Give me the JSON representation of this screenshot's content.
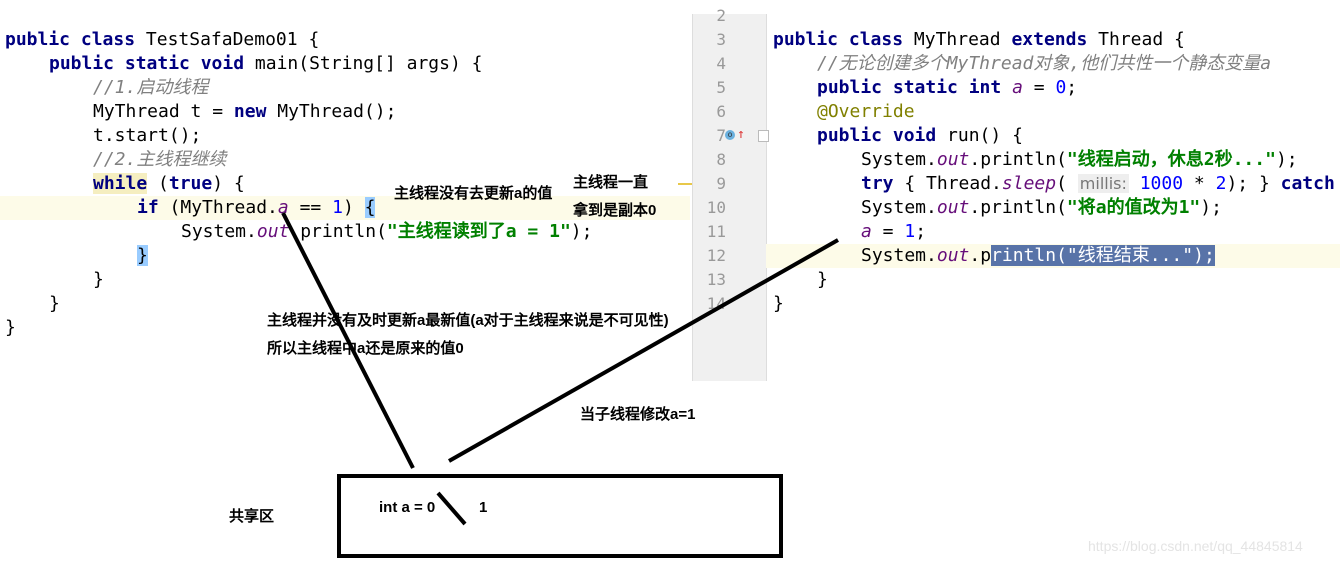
{
  "left_code": [
    {
      "indent": 0,
      "tokens": [
        [
          "public class ",
          "kw"
        ],
        [
          "TestSafaDemo01 {",
          ""
        ]
      ]
    },
    {
      "indent": 1,
      "tokens": [
        [
          "public static void ",
          "kw"
        ],
        [
          "main(String[] args) {",
          ""
        ]
      ]
    },
    {
      "indent": 2,
      "tokens": [
        [
          "//1.启动线程",
          "cm"
        ]
      ]
    },
    {
      "indent": 2,
      "tokens": [
        [
          "MyThread t = ",
          ""
        ],
        [
          "new ",
          "kw"
        ],
        [
          "MyThread();",
          ""
        ]
      ]
    },
    {
      "indent": 2,
      "tokens": [
        [
          "t.start();",
          ""
        ]
      ]
    },
    {
      "indent": 2,
      "tokens": [
        [
          "//2.主线程继续",
          "cm"
        ]
      ]
    },
    {
      "indent": 2,
      "tokens": [
        [
          "while",
          "kw whl"
        ],
        [
          " (",
          ""
        ],
        [
          "true",
          "kw"
        ],
        [
          ") {",
          ""
        ]
      ]
    },
    {
      "indent": 3,
      "tokens": [
        [
          "if ",
          "kw"
        ],
        [
          "(MyThread.",
          ""
        ],
        [
          "a",
          "fd"
        ],
        [
          " == ",
          ""
        ],
        [
          "1",
          "nu"
        ],
        [
          ") ",
          ""
        ],
        [
          "{",
          "brace"
        ]
      ]
    },
    {
      "indent": 4,
      "tokens": [
        [
          "System.",
          ""
        ],
        [
          "out",
          "fd"
        ],
        [
          ".println(",
          ""
        ],
        [
          "\"主线程读到了a = 1\"",
          "st"
        ],
        [
          ");",
          ""
        ]
      ]
    },
    {
      "indent": 3,
      "tokens": [
        [
          "}",
          "brace"
        ]
      ]
    },
    {
      "indent": 2,
      "tokens": [
        [
          "}",
          ""
        ]
      ]
    },
    {
      "indent": 1,
      "tokens": [
        [
          "}",
          ""
        ]
      ]
    },
    {
      "indent": 0,
      "tokens": [
        [
          "}",
          ""
        ]
      ]
    }
  ],
  "right_code": [
    {
      "num": "2",
      "indent": 0,
      "tokens": []
    },
    {
      "num": "3",
      "indent": 0,
      "tokens": [
        [
          "public class ",
          "kw"
        ],
        [
          "MyThread ",
          ""
        ],
        [
          "extends ",
          "kw"
        ],
        [
          "Thread {",
          ""
        ]
      ]
    },
    {
      "num": "4",
      "indent": 1,
      "tokens": [
        [
          "//无论创建多个MyThread对象,他们共性一个静态变量a",
          "cm"
        ]
      ]
    },
    {
      "num": "5",
      "indent": 1,
      "tokens": [
        [
          "public static int ",
          "kw"
        ],
        [
          "a",
          "fd"
        ],
        [
          " = ",
          ""
        ],
        [
          "0",
          "nu"
        ],
        [
          ";",
          ""
        ]
      ]
    },
    {
      "num": "6",
      "indent": 1,
      "tokens": [
        [
          "@Override",
          "an"
        ]
      ]
    },
    {
      "num": "7",
      "indent": 1,
      "tokens": [
        [
          "public void ",
          "kw"
        ],
        [
          "run() {",
          ""
        ]
      ]
    },
    {
      "num": "8",
      "indent": 2,
      "tokens": [
        [
          "System.",
          ""
        ],
        [
          "out",
          "fd"
        ],
        [
          ".println(",
          ""
        ],
        [
          "\"线程启动，休息2秒...\"",
          "st"
        ],
        [
          ");",
          ""
        ]
      ]
    },
    {
      "num": "9",
      "indent": 2,
      "tokens": [
        [
          "try ",
          "kw"
        ],
        [
          "{ Thread.",
          ""
        ],
        [
          "sleep",
          "fd"
        ],
        [
          "( ",
          ""
        ],
        [
          "millis:",
          "hint"
        ],
        [
          " ",
          ""
        ],
        [
          "1000",
          "nu"
        ],
        [
          " * ",
          ""
        ],
        [
          "2",
          "nu"
        ],
        [
          "); } ",
          ""
        ],
        [
          "catch",
          "kw"
        ]
      ]
    },
    {
      "num": "10",
      "indent": 2,
      "tokens": [
        [
          "System.",
          ""
        ],
        [
          "out",
          "fd"
        ],
        [
          ".println(",
          ""
        ],
        [
          "\"将a的值改为1\"",
          "st"
        ],
        [
          ");",
          ""
        ]
      ]
    },
    {
      "num": "11",
      "indent": 2,
      "tokens": [
        [
          "a",
          "fd"
        ],
        [
          " = ",
          ""
        ],
        [
          "1",
          "nu"
        ],
        [
          ";",
          ""
        ]
      ]
    },
    {
      "num": "12",
      "indent": 2,
      "tokens": [
        [
          "System.",
          ""
        ],
        [
          "out",
          "fd"
        ],
        [
          ".p",
          ""
        ],
        [
          "rintln(\"线程结束...\");",
          "sel"
        ]
      ]
    },
    {
      "num": "13",
      "indent": 1,
      "tokens": [
        [
          "}",
          ""
        ]
      ]
    },
    {
      "num": "14",
      "indent": 0,
      "tokens": [
        [
          "}",
          ""
        ]
      ]
    }
  ],
  "annotations": {
    "main_not_update": "主线程没有去更新a的值",
    "main_always_1": "主线程一直",
    "main_always_2": "拿到是副本0",
    "not_timely_1": "主线程并没有及时更新a最新值(a对于主线程来说是不可见性)",
    "not_timely_2": "所以主线程中a还是原来的值0",
    "child_modify": "当子线程修改a=1",
    "shared_area": "共享区",
    "box_text": "int a  = 0",
    "box_new_value": "1"
  },
  "icons": {
    "override_marker": "override-method-icon",
    "fold": "fold-marker-icon"
  },
  "watermark": "https://blog.csdn.net/qq_44845814"
}
